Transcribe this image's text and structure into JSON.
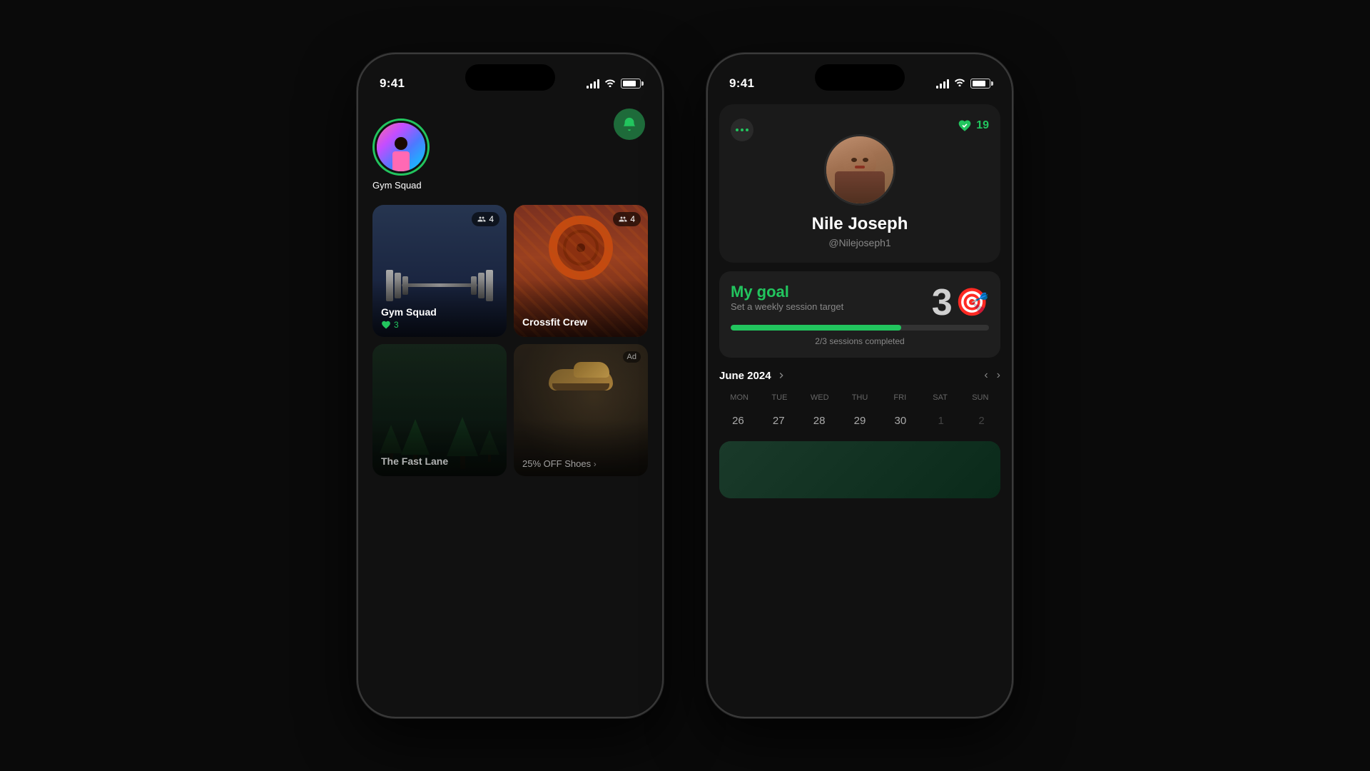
{
  "page": {
    "background": "#0a0a0a"
  },
  "phone1": {
    "time": "9:41",
    "screen": "feed",
    "notification_bell": "🔔",
    "user": {
      "name": "Gym Squad",
      "avatar_label": "user-avatar"
    },
    "groups": [
      {
        "id": "gym-squad",
        "title": "Gym Squad",
        "member_count": "4",
        "likes": "3",
        "type": "group"
      },
      {
        "id": "crossfit-crew",
        "title": "Crossfit Crew",
        "member_count": "4",
        "type": "group"
      },
      {
        "id": "fast-lane",
        "title": "The Fast Lane",
        "type": "group"
      },
      {
        "id": "ad-shoes",
        "title": "25% OFF Shoes",
        "cta": ">",
        "type": "ad",
        "ad_label": "Ad"
      }
    ]
  },
  "phone2": {
    "time": "9:41",
    "screen": "profile",
    "user": {
      "name": "Nile Joseph",
      "handle": "@Nilejoseph1",
      "heart_count": "19"
    },
    "goal": {
      "title": "My goal",
      "subtitle": "Set a weekly session target",
      "target_number": "3",
      "progress_text": "2/3 sessions completed",
      "progress_percent": 66
    },
    "calendar": {
      "month": "June 2024",
      "days_labels": [
        "MON",
        "TUE",
        "WED",
        "THU",
        "FRI",
        "SAT",
        "SUN"
      ],
      "dates": [
        "26",
        "27",
        "28",
        "29",
        "30",
        "1",
        "2"
      ],
      "faded_dates": [
        "1",
        "2"
      ]
    }
  }
}
